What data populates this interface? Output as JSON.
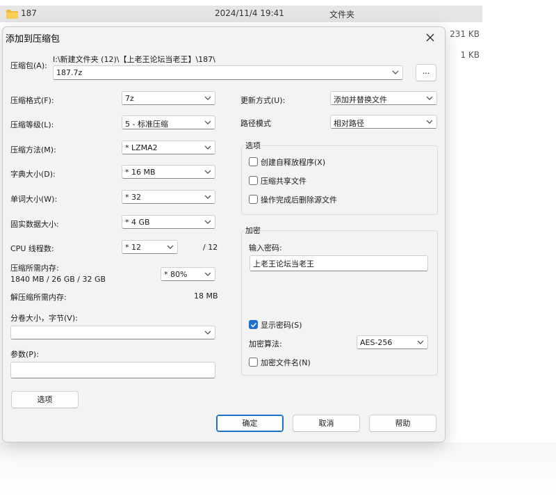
{
  "explorer": {
    "row": {
      "name": "187",
      "date": "2024/11/4 19:41",
      "type": "文件夹"
    },
    "sizes": [
      "231 KB",
      "1 KB"
    ]
  },
  "dialog": {
    "title": "添加到压缩包",
    "archive": {
      "label": "压缩包(A):",
      "path": "I:\\新建文件夹 (12)\\【上老王论坛当老王】\\187\\",
      "value": "187.7z",
      "browse_label": "..."
    },
    "left": {
      "format": {
        "label": "压缩格式(F):",
        "value": "7z"
      },
      "level": {
        "label": "压缩等级(L):",
        "value": "5 - 标准压缩"
      },
      "method": {
        "label": "压缩方法(M):",
        "value": "*  LZMA2"
      },
      "dict": {
        "label": "字典大小(D):",
        "value": "*  16 MB"
      },
      "word": {
        "label": "单词大小(W):",
        "value": "*  32"
      },
      "solid": {
        "label": "固实数据大小:",
        "value": "*  4 GB"
      },
      "threads": {
        "label": "CPU 线程数:",
        "value": "*  12",
        "max": "/ 12"
      },
      "mem": {
        "label": "压缩所需内存:",
        "detail": "1840 MB / 26 GB / 32 GB",
        "value": "*  80%"
      },
      "decomp": {
        "label": "解压缩所需内存:",
        "value": "18 MB"
      },
      "volume": {
        "label": "分卷大小，字节(V):",
        "value": ""
      },
      "params": {
        "label": "参数(P):",
        "value": ""
      },
      "options_button": "选项"
    },
    "right": {
      "update": {
        "label": "更新方式(U):",
        "value": "添加并替换文件"
      },
      "path_mode": {
        "label": "路径模式",
        "value": "相对路径"
      },
      "options_group": {
        "title": "选项",
        "items": [
          {
            "label": "创建自释放程序(X)",
            "checked": false
          },
          {
            "label": "压缩共享文件",
            "checked": false
          },
          {
            "label": "操作完成后删除源文件",
            "checked": false
          }
        ]
      },
      "encryption": {
        "title": "加密",
        "password_label": "输入密码:",
        "password_value": "上老王论坛当老王",
        "show_password": {
          "label": "显示密码(S)",
          "checked": true
        },
        "method_label": "加密算法:",
        "method_value": "AES-256",
        "encrypt_names": {
          "label": "加密文件名(N)",
          "checked": false
        }
      }
    },
    "buttons": {
      "ok": "确定",
      "cancel": "取消",
      "help": "帮助"
    }
  },
  "colors": {
    "accent": "#1a6fd0",
    "dialog_bg": "#f3f3f3"
  }
}
